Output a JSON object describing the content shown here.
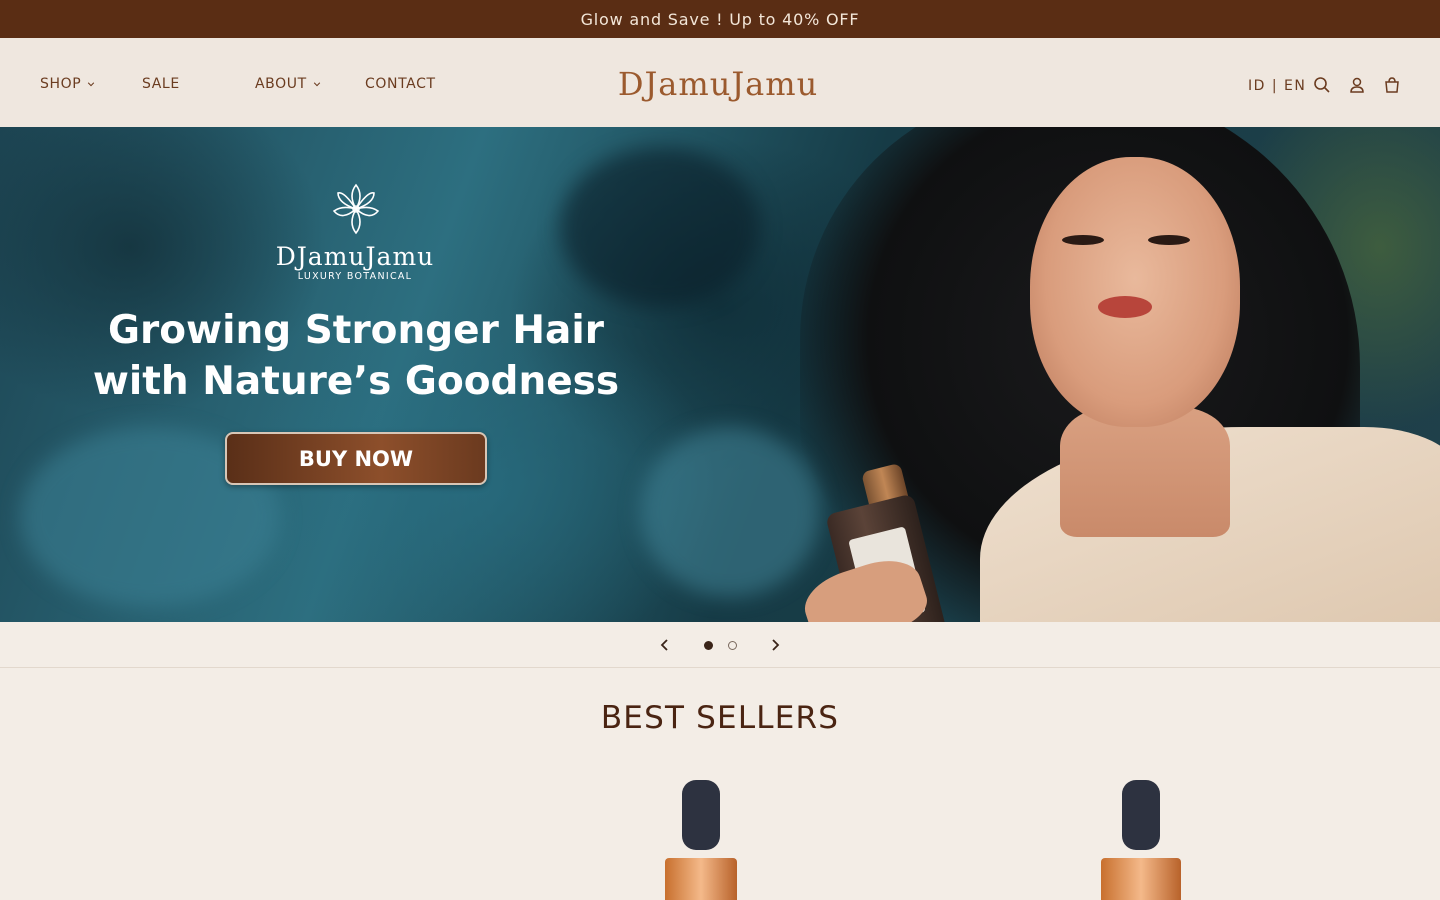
{
  "announcement": {
    "text": "Glow and Save ! Up to 40% OFF"
  },
  "nav": {
    "items": [
      {
        "label": "SHOP",
        "has_dropdown": true
      },
      {
        "label": "SALE",
        "has_dropdown": false
      },
      {
        "label": "ABOUT",
        "has_dropdown": true
      },
      {
        "label": "CONTACT",
        "has_dropdown": false
      }
    ]
  },
  "logo": {
    "text": "DJamuJamu"
  },
  "header": {
    "language": "ID | EN",
    "icons": [
      "search-icon",
      "account-icon",
      "cart-icon"
    ]
  },
  "hero": {
    "brand_name": "DJamuJamu",
    "brand_tagline": "LUXURY BOTANICAL",
    "headline_line1": "Growing Stronger Hair",
    "headline_line2": "with Nature’s Goodness",
    "cta_label": "BUY NOW"
  },
  "slider": {
    "slides_total": 2,
    "active_slide": 1
  },
  "best_sellers": {
    "title": "BEST SELLERS"
  },
  "colors": {
    "announcement_bg": "#5a2d14",
    "header_bg": "#efe7df",
    "page_bg": "#f3ede6",
    "logo": "#9b5a2e",
    "accent_brown": "#6b3c20"
  }
}
